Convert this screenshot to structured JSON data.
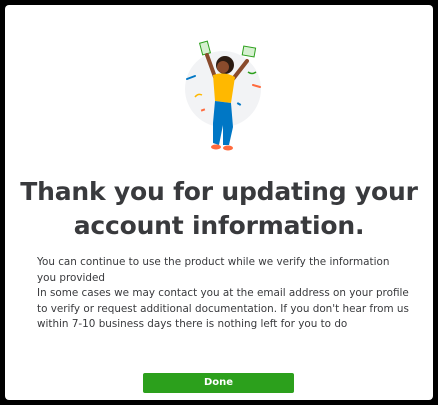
{
  "dialog": {
    "illustration_icon": "celebrating-person-illustration",
    "title": "Thank you for updating your account information.",
    "paragraphs": [
      "You can continue to use the product while we verify the information you provided",
      "In some cases we may contact you at the email address on your profile to verify or request additional documentation. If you don't hear from us within 7-10 business days there is nothing left for you to do"
    ],
    "done_label": "Done"
  },
  "colors": {
    "primary_button": "#2ca01c",
    "text": "#393a3d",
    "background": "#ffffff",
    "frame": "#000000"
  }
}
